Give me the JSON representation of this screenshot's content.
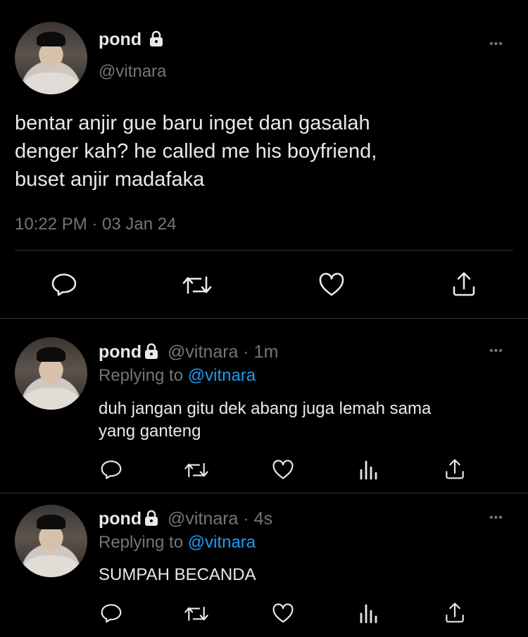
{
  "main_tweet": {
    "name": "pond",
    "handle": "@vitnara",
    "text_lines": [
      "bentar anjir gue baru inget dan gasalah",
      "denger kah? he called me his boyfriend,",
      "buset anjir madafaka"
    ],
    "timestamp": "10:22 PM · 03 Jan 24",
    "more": "•••"
  },
  "replies": [
    {
      "name": "pond",
      "handle_time": "@vitnara · 1m",
      "replying_label": "Replying to",
      "replying_to": "@vitnara",
      "text_lines": [
        "duh jangan gitu dek abang juga lemah sama",
        "yang ganteng"
      ],
      "more": "•••"
    },
    {
      "name": "pond",
      "handle_time": "@vitnara · 4s",
      "replying_label": "Replying to",
      "replying_to": "@vitnara",
      "text_lines": [
        "SUMPAH BECANDA"
      ],
      "more": "•••"
    }
  ],
  "icons": {
    "reply": "reply-icon",
    "retweet": "retweet-icon",
    "like": "heart-icon",
    "share": "share-icon",
    "views": "views-icon",
    "lock": "lock-icon"
  },
  "colors": {
    "background": "#000000",
    "text": "#e7e9ea",
    "muted": "#71767b",
    "link": "#1d9bf0",
    "divider": "#2f3336"
  }
}
